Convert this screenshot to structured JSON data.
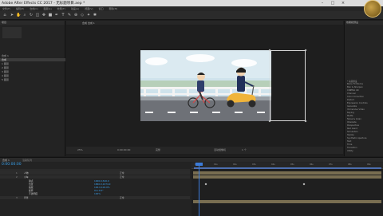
{
  "title_bar": {
    "title": "Adobe After Effects CC 2017 - 无标题项目.aep *"
  },
  "menu": [
    "文件(F)",
    "编辑(E)",
    "合成(C)",
    "图层(L)",
    "效果(T)",
    "动画(A)",
    "视图(V)",
    "窗口",
    "帮助(H)"
  ],
  "project_panel": {
    "tab_label": "项目",
    "rows": [
      "合成 1",
      "合成",
      "1 图层",
      "2 图层",
      "3 图层",
      "4 图层",
      "5 图层"
    ]
  },
  "viewer": {
    "tab_label": "合成 合成 1",
    "zoom": "25%",
    "timecode": "0:00:00:00",
    "resolution": "完整",
    "camera": "活动摄像机",
    "views": "1 个"
  },
  "right_panel": {
    "section_title": "效果和预设",
    "items": [
      "* 动画预设",
      "Boris FX Mocha",
      "Blur & Sharpen",
      "CINEMA 4D",
      "Channel",
      "Color Correction",
      "Distort",
      "Expression Controls",
      "Generate",
      "Immersive Video",
      "Keying",
      "Matte",
      "Noise & Grain",
      "Obsolete",
      "Perspective",
      "Red Giant",
      "Simulation",
      "Stylize",
      "Synthetic Aperture",
      "Text",
      "Time",
      "Transition",
      "Utility"
    ]
  },
  "timeline": {
    "tabs": [
      "合成 1",
      "渲染队列"
    ],
    "timecode": "0:00:00:00",
    "ruler_ticks": [
      "00s",
      "01s",
      "02s",
      "03s",
      "04s",
      "05s",
      "06s",
      "07s",
      "08s",
      "09s"
    ],
    "layers": [
      {
        "num": "1",
        "name": "人物",
        "mode": "正常"
      },
      {
        "num": "2",
        "name": "小车",
        "mode": "正常"
      },
      {
        "num": "",
        "name": "锚点",
        "mode": "1000.0,540.0"
      },
      {
        "num": "",
        "name": "位置",
        "mode": "1860.0,1074.0"
      },
      {
        "num": "",
        "name": "缩放",
        "mode": "100.0,100.0%"
      },
      {
        "num": "",
        "name": "旋转",
        "mode": "0x+0.0°"
      },
      {
        "num": "",
        "name": "不透明度",
        "mode": "100%"
      },
      {
        "num": "3",
        "name": "背景",
        "mode": "正常"
      }
    ]
  },
  "colors": {
    "accent": "#3b7bd9",
    "timecode": "#3aa2ee",
    "layer_bar": "#8a7d5a",
    "sky": "#cfe3ec",
    "road": "#6e7177",
    "scooter": "#f0b43a"
  }
}
